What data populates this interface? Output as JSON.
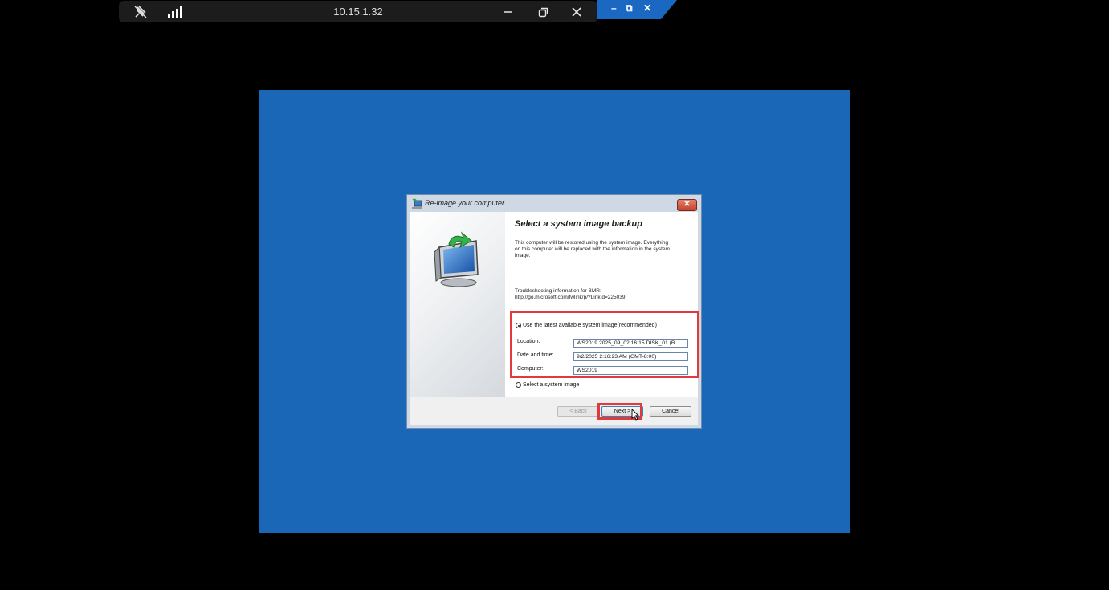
{
  "remote_bar": {
    "ip": "10.15.1.32",
    "pin_icon": "unpin-icon",
    "signal_icon": "signal-strength-icon",
    "minimize_icon": "minimize-icon",
    "restore_icon": "restore-icon",
    "close_icon": "close-icon"
  },
  "remote_window_controls": {
    "minimize": "–",
    "restore": "⧉",
    "close": "✕"
  },
  "dialog": {
    "title": "Re-image your computer",
    "close_glyph": "✕",
    "heading": "Select a system image backup",
    "description": "This computer will be restored using the system image. Everything on this computer will be replaced with the information in the system image.",
    "troubleshooting_line1": "Troubleshooting information for BMR:",
    "troubleshooting_line2": "http://go.microsoft.com/fwlink/p/?LinkId=225039",
    "option_latest": "Use the latest available system image(recommended)",
    "option_latest_selected": true,
    "location_label": "Location:",
    "location_value": "WS2019 2025_09_02 16:15 DISK_01 (B",
    "datetime_label": "Date and time:",
    "datetime_value": "9/2/2025 2:16:23 AM (GMT-8:00)",
    "computer_label": "Computer:",
    "computer_value": "WS2019",
    "option_select": "Select a system image",
    "back_label": "< Back",
    "next_label": "Next >",
    "cancel_label": "Cancel"
  },
  "colors": {
    "screen_background": "#1a67b7",
    "highlight": "#e13a3a"
  }
}
